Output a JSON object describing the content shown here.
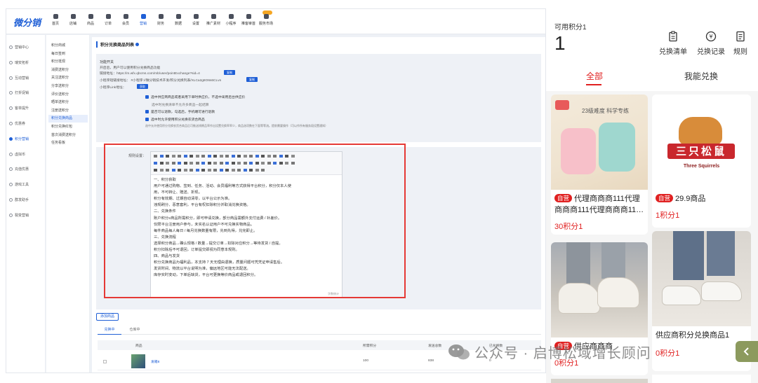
{
  "admin": {
    "logo": "微分销",
    "topnav": [
      "首页",
      "店铺",
      "商品",
      "订单",
      "会员",
      "营销",
      "财务",
      "数据",
      "设置",
      "推广素材",
      "小程序",
      "推客审首",
      "服务市场"
    ],
    "active_nav": 5,
    "side1": [
      "营销中心",
      "瑞安拓析",
      "互动营销",
      "打折促销",
      "客单提升",
      "优惠券",
      "积分营销",
      "虚拟币",
      "充值优惠",
      "游戏工具",
      "群发助手",
      "裂变营销"
    ],
    "side1_active": 6,
    "side2": [
      "积分商城",
      "每日签到",
      "积分抵现",
      "消费送积分",
      "关注送积分",
      "分享送积分",
      "评价送积分",
      "晒单送积分",
      "注册送积分",
      "积分兑换商品",
      "积分兑换红包",
      "首次消费送积分",
      "任务看板"
    ],
    "side2_active": 9,
    "page_title": "积分兑换商品列表",
    "config": {
      "heading": "功能开关",
      "desc": "开启后，用户可以使用积分兑换商品功能",
      "link_label": "链接地址：https://m.wfx.qbcms.com/mb/user/pointExchange?sid=4",
      "copy_btn": "复制",
      "mini_label": "小程序短链接地址：  #小程序://微分销技术开发/积分兑换列表/XLCa2g8O6s6CLvn",
      "mini_btn": "复制",
      "link2_label": "小程序Link地址：",
      "link2_btn": "获取",
      "check1": "选中供应商商品或者采用下单时供应价，不选中采用后台供应价",
      "check1_note": "选中时兑换清单不允许多商品一起结算",
      "check2": "是否可以退款，勾选后，手机端可进行退款",
      "check3": "选中时允许使用积分兑换农货合商品",
      "note": "选中允许使用积分兑换农货合商品后可推送线棉品率作出设置兑换率率少，商品选项数在下面等等流。提前需要操作（可以作所有服务段设置通知）"
    },
    "rules_label": "规则设置：",
    "editor_lines": [
      "一、积分获取",
      "用户可通过购物、签到、任务、活动、会员福利等方式获得平台积分，积分仅本人使",
      "用，不可转让、赠送、折现。",
      "积分有效期、过期自动清零，以平台公示为准。",
      "违规刷分、恶意套利，平台有权扣除积分并取消兑换资格。",
      "二、兑换条件",
      "账户积分≥商品所需积分，即可申请兑换，部分商品需额外支付运费 / 补差价。",
      "仅限平台注册用户参与，未实名认证用户不可兑换实物商品。",
      "每件商品每人每日 / 每月兑换数量有限，先到先得，兑完即止。",
      "三、兑换流程",
      "选择积分商品→确认规格 / 数量→提交订单→扣除对应积分→等待发货 / 自提。",
      "积分扣除后不可退回，订单提交即视为同意本规则。",
      "四、商品与发货",
      "积分兑换商品为福利品，本支持 7 天无理由退换，质量问题可凭凭证申请售后。",
      "发货时间、物流以平台说明为准，偏远地区可能无法配送。",
      "库存实时变动，下单后缺货，平台可更换等价商品或退回积分。"
    ],
    "editor_count": "字数统计",
    "add_btn": "添加商品",
    "tabs": [
      "兑换中",
      "仓库中"
    ],
    "columns": [
      "商品",
      "所需积分",
      "发送总数",
      "已兑换数"
    ],
    "row": {
      "name": "发箱8",
      "points": "100",
      "total": "838",
      "exchanged": "0"
    }
  },
  "mobile": {
    "points_label": "可用积分1",
    "points_value": "1",
    "actions": [
      {
        "label": "兑换清单",
        "icon": "clipboard-icon"
      },
      {
        "label": "兑换记录",
        "icon": "yen-coin-icon"
      },
      {
        "label": "规则",
        "icon": "document-icon"
      }
    ],
    "tabs": [
      "全部",
      "我能兑换"
    ],
    "tag": "自营",
    "cards": [
      {
        "title": "代理商商商111代理商商商111代理商商商11…",
        "points": "30积分1",
        "tagged": true,
        "img_top": "23级难度 科学专练"
      },
      {
        "title": "29.9商品",
        "points": "1积分1",
        "tagged": true,
        "brand": "三只松鼠",
        "brand_en": "Three Squirrels"
      },
      {
        "title": "供应商商商",
        "points": "0积分1",
        "tagged": true
      },
      {
        "title": "供应商积分兑换商品1",
        "points": "0积分1",
        "tagged": false
      }
    ],
    "watermark": "公众号 · 启博松域增长顾问",
    "colors": {
      "accent": "#e02020",
      "brand_blue": "#1f5fd6"
    }
  }
}
